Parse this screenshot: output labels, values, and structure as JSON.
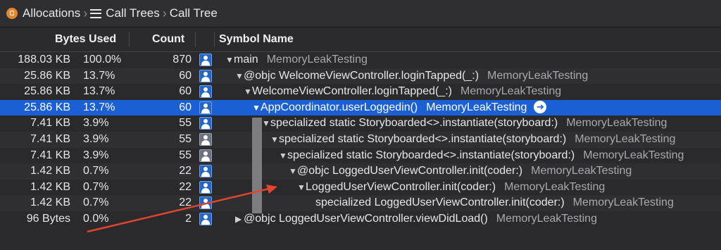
{
  "breadcrumb": {
    "items": [
      "Allocations",
      "Call Trees",
      "Call Tree"
    ]
  },
  "columns": {
    "bytes_used": "Bytes Used",
    "count": "Count",
    "symbol_name": "Symbol Name"
  },
  "rows": [
    {
      "bytes": "188.03 KB",
      "pct": "100.0%",
      "count": "870",
      "symbol": "main",
      "library": "MemoryLeakTesting",
      "expanded": true
    },
    {
      "bytes": "25.86 KB",
      "pct": "13.7%",
      "count": "60",
      "symbol": "@objc WelcomeViewController.loginTapped(_:)",
      "library": "MemoryLeakTesting",
      "expanded": true
    },
    {
      "bytes": "25.86 KB",
      "pct": "13.7%",
      "count": "60",
      "symbol": "WelcomeViewController.loginTapped(_:)",
      "library": "MemoryLeakTesting",
      "expanded": true
    },
    {
      "bytes": "25.86 KB",
      "pct": "13.7%",
      "count": "60",
      "symbol": "AppCoordinator.userLoggedin()",
      "library": "MemoryLeakTesting",
      "expanded": true,
      "selected": true
    },
    {
      "bytes": "7.41 KB",
      "pct": "3.9%",
      "count": "55",
      "symbol": "specialized static Storyboarded<>.instantiate(storyboard:)",
      "library": "MemoryLeakTesting",
      "expanded": true
    },
    {
      "bytes": "7.41 KB",
      "pct": "3.9%",
      "count": "55",
      "symbol": "specialized static Storyboarded<>.instantiate(storyboard:)",
      "library": "MemoryLeakTesting",
      "expanded": true
    },
    {
      "bytes": "7.41 KB",
      "pct": "3.9%",
      "count": "55",
      "symbol": "specialized static Storyboarded<>.instantiate(storyboard:)",
      "library": "MemoryLeakTesting",
      "expanded": true
    },
    {
      "bytes": "1.42 KB",
      "pct": "0.7%",
      "count": "22",
      "symbol": "@objc LoggedUserViewController.init(coder:)",
      "library": "MemoryLeakTesting",
      "expanded": true
    },
    {
      "bytes": "1.42 KB",
      "pct": "0.7%",
      "count": "22",
      "symbol": "LoggedUserViewController.init(coder:)",
      "library": "MemoryLeakTesting",
      "expanded": true
    },
    {
      "bytes": "1.42 KB",
      "pct": "0.7%",
      "count": "22",
      "symbol": "specialized LoggedUserViewController.init(coder:)",
      "library": "MemoryLeakTesting"
    },
    {
      "bytes": "96 Bytes",
      "pct": "0.0%",
      "count": "2",
      "symbol": "@objc LoggedUserViewController.viewDidLoad()",
      "library": "MemoryLeakTesting",
      "expanded": false
    }
  ],
  "icons": {
    "expanded": "▼",
    "collapsed": "▶",
    "go": "➔"
  },
  "colors": {
    "selection": "#1a5fd4",
    "annotation_arrow": "#e0452f"
  }
}
